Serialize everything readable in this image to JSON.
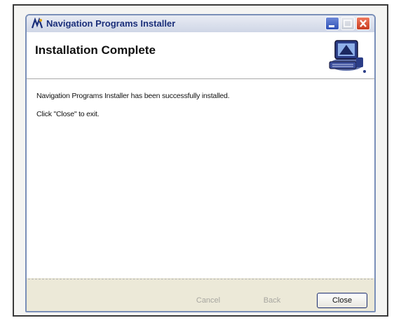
{
  "window": {
    "title": "Navigation Programs Installer",
    "icon": "app-logo-icon"
  },
  "header": {
    "title": "Installation Complete",
    "graphic": "computer-install-icon"
  },
  "body": {
    "message": "Navigation Programs Installer has been successfully installed.",
    "instruction": "Click \"Close\" to exit."
  },
  "footer": {
    "cancel_label": "Cancel",
    "back_label": "Back",
    "close_label": "Close"
  },
  "colors": {
    "title_text": "#1b2f7a",
    "close_button": "#c73a1f",
    "minimize_button": "#2e4fb6"
  }
}
